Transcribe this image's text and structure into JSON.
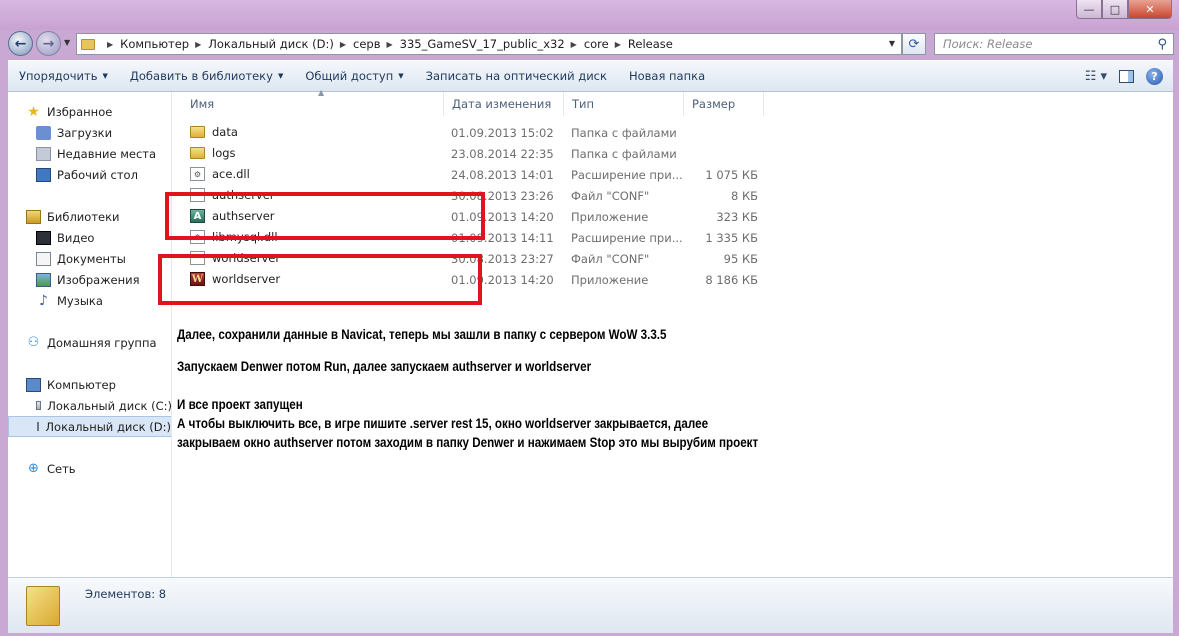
{
  "window": {
    "title": "",
    "caption_buttons": {
      "minimize": "—",
      "maximize": "□",
      "close": "✕"
    }
  },
  "address": {
    "breadcrumbs": [
      "Компьютер",
      "Локальный диск (D:)",
      "серв",
      "335_GameSV_17_public_x32",
      "core",
      "Release"
    ],
    "search_placeholder": "Поиск: Release"
  },
  "toolbar": {
    "organize": "Упорядочить",
    "add_to_library": "Добавить в библиотеку",
    "share": "Общий доступ",
    "burn": "Записать на оптический диск",
    "new_folder": "Новая папка"
  },
  "nav": {
    "favorites": "Избранное",
    "downloads": "Загрузки",
    "recent": "Недавние места",
    "desktop": "Рабочий стол",
    "libraries": "Библиотеки",
    "video": "Видео",
    "documents": "Документы",
    "images": "Изображения",
    "music": "Музыка",
    "homegroup": "Домашняя группа",
    "computer": "Компьютер",
    "drive_c": "Локальный диск (C:)",
    "drive_d": "Локальный диск (D:)",
    "network": "Сеть"
  },
  "columns": {
    "name": "Имя",
    "date": "Дата изменения",
    "type": "Тип",
    "size": "Размер"
  },
  "files": [
    {
      "name": "data",
      "date": "01.09.2013 15:02",
      "type": "Папка с файлами",
      "size": "",
      "icon": "folder-icon"
    },
    {
      "name": "logs",
      "date": "23.08.2014 22:35",
      "type": "Папка с файлами",
      "size": "",
      "icon": "folder-icon"
    },
    {
      "name": "ace.dll",
      "date": "24.08.2013 14:01",
      "type": "Расширение при...",
      "size": "1 075 КБ",
      "icon": "dll-file-icon"
    },
    {
      "name": "authserver",
      "date": "30.08.2013 23:26",
      "type": "Файл \"CONF\"",
      "size": "8 КБ",
      "icon": "conf-file-icon"
    },
    {
      "name": "authserver",
      "date": "01.09.2013 14:20",
      "type": "Приложение",
      "size": "323 КБ",
      "icon": "authserver-app-icon"
    },
    {
      "name": "libmysql.dll",
      "date": "01.09.2013 14:11",
      "type": "Расширение при...",
      "size": "1 335 КБ",
      "icon": "dll-file-icon"
    },
    {
      "name": "worldserver",
      "date": "30.08.2013 23:27",
      "type": "Файл \"CONF\"",
      "size": "95 КБ",
      "icon": "conf-file-icon"
    },
    {
      "name": "worldserver",
      "date": "01.09.2013 14:20",
      "type": "Приложение",
      "size": "8 186 КБ",
      "icon": "worldserver-app-icon"
    }
  ],
  "notes": {
    "line1": "Далее, сохранили данные в Navicat, теперь мы зашли в папку с сервером WoW 3.3.5",
    "line2": "Запускаем Denwer потом Run, далее запускаем authserver и worldserver",
    "line3": "И все проект запущен",
    "line4": "А чтобы выключить все, в игре пишите .server rest 15, окно worldserver закрывается, далее",
    "line5": "закрываем окно authserver потом заходим в папку Denwer и нажимаем Stop это мы вырубим проект"
  },
  "status": {
    "items_count": "Элементов: 8"
  },
  "colors": {
    "annotation_red": "#e0141e",
    "window_frame": "#c9a9d3"
  }
}
